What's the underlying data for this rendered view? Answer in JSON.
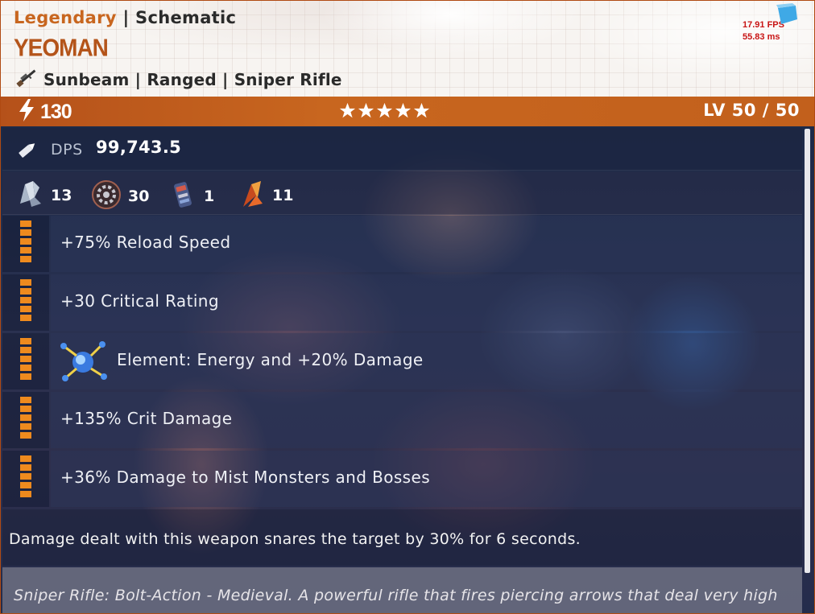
{
  "header": {
    "rarity": "Legendary",
    "separator": "|",
    "type": "Schematic",
    "name": "YEOMAN",
    "category": "Sunbeam | Ranged | Sniper Rifle",
    "category_icon": "sniper-rifle-icon"
  },
  "overlay": {
    "fps": "17.91 FPS",
    "ms": "55.83 ms"
  },
  "statbar": {
    "power_icon": "lightning-icon",
    "power": "130",
    "stars": 5,
    "level": "LV 50 / 50"
  },
  "dps": {
    "label": "DPS",
    "value": "99,743.5",
    "icon": "bullet-icon"
  },
  "resources": [
    {
      "icon": "crystal-icon",
      "count": "13"
    },
    {
      "icon": "gear-icon",
      "count": "30"
    },
    {
      "icon": "mechanical-parts-icon",
      "count": "1"
    },
    {
      "icon": "flame-shard-icon",
      "count": "11"
    }
  ],
  "perks": [
    {
      "text": "+75% Reload Speed",
      "icon": null
    },
    {
      "text": "+30 Critical Rating",
      "icon": null
    },
    {
      "text": "Element: Energy and +20% Damage",
      "icon": "energy-element-icon"
    },
    {
      "text": "+135% Crit Damage",
      "icon": null
    },
    {
      "text": "+36% Damage to Mist Monsters and Bosses",
      "icon": null
    }
  ],
  "description": "Damage dealt with this weapon snares the target by 30% for 6 seconds.",
  "lore": "Sniper Rifle: Bolt-Action - Medieval. A powerful rifle that fires piercing arrows that deal very high",
  "colors": {
    "rarity": "#c8661f",
    "statbar": "#c2601c",
    "perk_bar": "#ee8a1e",
    "fps": "#c81414"
  }
}
